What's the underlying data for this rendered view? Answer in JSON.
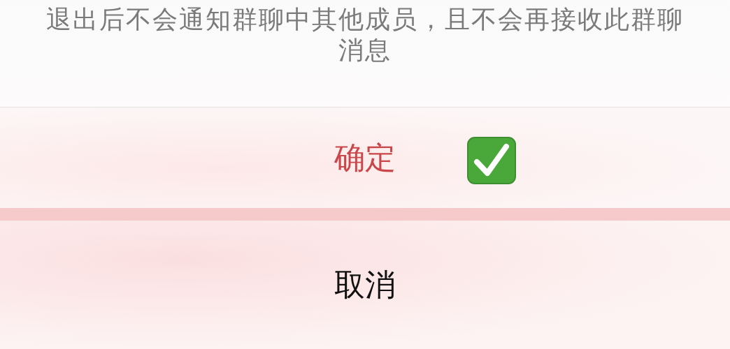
{
  "message": "退出后不会通知群聊中其他成员，且不会再接收此群聊消息",
  "actions": [
    {
      "label": "确定",
      "kind": "destructive",
      "checkmark": true
    },
    {
      "label": "取消",
      "kind": "cancel",
      "checkmark": false
    }
  ]
}
